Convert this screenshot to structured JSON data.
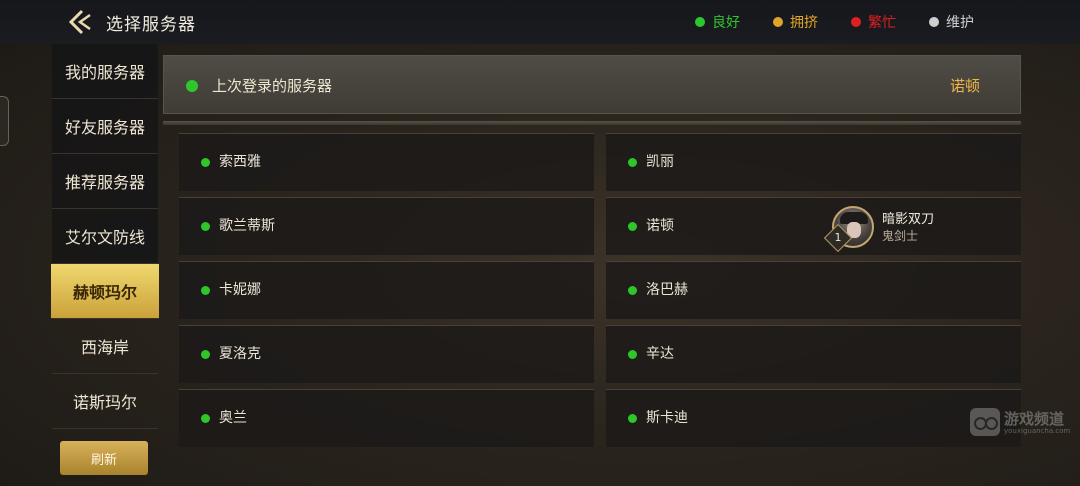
{
  "header": {
    "title": "选择服务器",
    "status_legend": [
      {
        "label": "良好",
        "color": "#2dc62d"
      },
      {
        "label": "拥挤",
        "color": "#e0a428"
      },
      {
        "label": "繁忙",
        "color": "#e02020"
      },
      {
        "label": "维护",
        "color": "#cfcfcf"
      }
    ]
  },
  "sidebar": {
    "items": [
      {
        "label": "我的服务器",
        "active": false
      },
      {
        "label": "好友服务器",
        "active": false
      },
      {
        "label": "推荐服务器",
        "active": false
      },
      {
        "label": "艾尔文防线",
        "active": false
      },
      {
        "label": "赫顿玛尔",
        "active": true
      },
      {
        "label": "西海岸",
        "active": false
      },
      {
        "label": "诺斯玛尔",
        "active": false
      }
    ],
    "refresh_label": "刷新"
  },
  "last_login": {
    "label": "上次登录的服务器",
    "server": "诺顿",
    "status": "良好"
  },
  "servers": [
    {
      "name": "索西雅",
      "status": "良好"
    },
    {
      "name": "凯丽",
      "status": "良好"
    },
    {
      "name": "歌兰蒂斯",
      "status": "良好"
    },
    {
      "name": "诺顿",
      "status": "良好",
      "character": {
        "name": "暗影双刀",
        "class": "鬼剑士",
        "level_badge": "1"
      }
    },
    {
      "name": "卡妮娜",
      "status": "良好"
    },
    {
      "name": "洛巴赫",
      "status": "良好"
    },
    {
      "name": "夏洛克",
      "status": "良好"
    },
    {
      "name": "辛达",
      "status": "良好"
    },
    {
      "name": "奥兰",
      "status": "良好"
    },
    {
      "name": "斯卡迪",
      "status": "良好"
    }
  ],
  "watermark": {
    "text": "游戏频道",
    "url_text": "youxiguancha.com"
  }
}
